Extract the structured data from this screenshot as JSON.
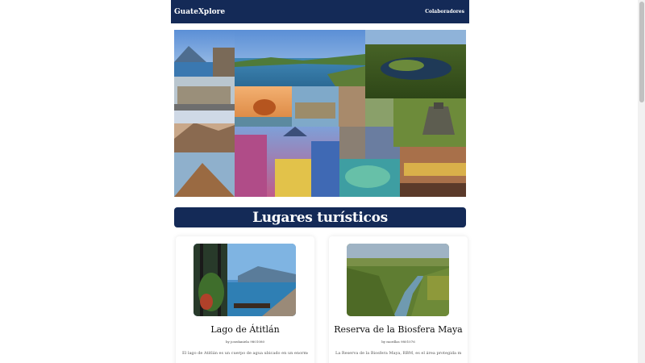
{
  "navbar": {
    "brand": "GuateXplore",
    "link": "Colaboradores"
  },
  "hero": {
    "alt_icon": "photo-collage"
  },
  "section": {
    "title": "Lugares turísticos"
  },
  "cards": [
    {
      "title": "Lago de Átitlán",
      "meta": "by josedaniela 9801080",
      "text": "El lago de Atitlán es un cuerpo de agua ubicado en un enorme"
    },
    {
      "title": "Reserva de la Biosfera Maya",
      "meta": "by morillas 9801076",
      "text": "La Reserva de la Biosfera Maya, RBM, es el área protegida más"
    }
  ],
  "colors": {
    "navy": "#142a57",
    "white": "#ffffff"
  }
}
